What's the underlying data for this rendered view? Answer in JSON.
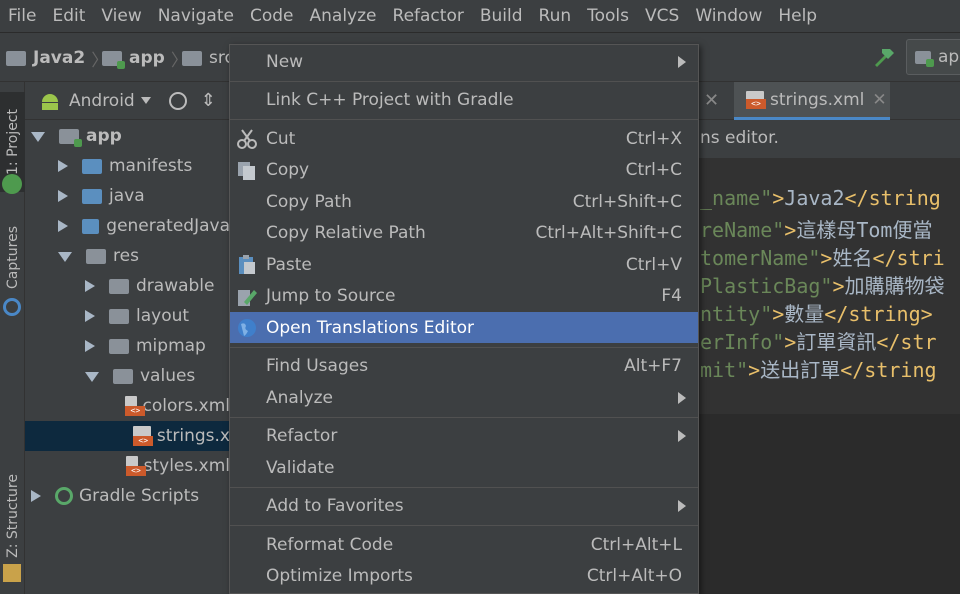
{
  "menubar": {
    "items": [
      "File",
      "Edit",
      "View",
      "Navigate",
      "Code",
      "Analyze",
      "Refactor",
      "Build",
      "Run",
      "Tools",
      "VCS",
      "Window",
      "Help"
    ]
  },
  "navbar": {
    "crumbs": [
      "Java2",
      "app",
      "src"
    ],
    "right_tab": "ap"
  },
  "toolwindows": {
    "project": "1: Project",
    "captures": "Captures",
    "structure": "Z: Structure"
  },
  "project_view": {
    "mode": "Android",
    "tree": [
      {
        "label": "app",
        "level": 0,
        "expanded": true,
        "bold": true
      },
      {
        "label": "manifests",
        "level": 1,
        "expanded": false
      },
      {
        "label": "java",
        "level": 1,
        "expanded": false
      },
      {
        "label": "generatedJava",
        "level": 1,
        "expanded": false
      },
      {
        "label": "res",
        "level": 1,
        "expanded": true
      },
      {
        "label": "drawable",
        "level": 2,
        "expanded": false
      },
      {
        "label": "layout",
        "level": 2,
        "expanded": false
      },
      {
        "label": "mipmap",
        "level": 2,
        "expanded": false
      },
      {
        "label": "values",
        "level": 2,
        "expanded": true
      },
      {
        "label": "colors.xml",
        "level": 3
      },
      {
        "label": "strings.x",
        "level": 3,
        "selected": true
      },
      {
        "label": "styles.xml",
        "level": 3
      },
      {
        "label": "Gradle Scripts",
        "level": 0,
        "expanded": false
      }
    ]
  },
  "editor": {
    "tab": "strings.xml",
    "info": "ns editor.",
    "lines": [
      {
        "attr": "_name\"",
        "text": "Java2",
        "close": "</string"
      },
      {
        "attr": "reName\"",
        "text": "這樣母Tom便當",
        "close": ""
      },
      {
        "attr": "tomerName\"",
        "text": "姓名",
        "close": "</stri"
      },
      {
        "attr": "PlasticBag\"",
        "text": "加購購物袋",
        "close": ""
      },
      {
        "attr": "ntity\"",
        "text": "數量",
        "close": "</string>"
      },
      {
        "attr": "erInfo\"",
        "text": "訂單資訊",
        "close": "</str"
      },
      {
        "attr": "mit\"",
        "text": "送出訂單",
        "close": "</string"
      }
    ]
  },
  "context_menu": {
    "items": [
      {
        "label": "New",
        "shortcut": "",
        "submenu": true,
        "icon": ""
      },
      {
        "sep": true
      },
      {
        "label": "Link C++ Project with Gradle",
        "shortcut": "",
        "icon": ""
      },
      {
        "sep": true
      },
      {
        "label": "Cut",
        "shortcut": "Ctrl+X",
        "icon": "scissors-icon"
      },
      {
        "label": "Copy",
        "shortcut": "Ctrl+C",
        "icon": "copy-icon"
      },
      {
        "label": "Copy Path",
        "shortcut": "Ctrl+Shift+C",
        "icon": ""
      },
      {
        "label": "Copy Relative Path",
        "shortcut": "Ctrl+Alt+Shift+C",
        "icon": ""
      },
      {
        "label": "Paste",
        "shortcut": "Ctrl+V",
        "icon": "paste-icon"
      },
      {
        "label": "Jump to Source",
        "shortcut": "F4",
        "icon": "edit-icon"
      },
      {
        "label": "Open Translations Editor",
        "shortcut": "",
        "icon": "globe-icon",
        "highlighted": true
      },
      {
        "sep": true
      },
      {
        "label": "Find Usages",
        "shortcut": "Alt+F7",
        "icon": ""
      },
      {
        "label": "Analyze",
        "shortcut": "",
        "submenu": true,
        "icon": ""
      },
      {
        "sep": true
      },
      {
        "label": "Refactor",
        "shortcut": "",
        "submenu": true,
        "icon": ""
      },
      {
        "label": "Validate",
        "shortcut": "",
        "icon": ""
      },
      {
        "sep": true
      },
      {
        "label": "Add to Favorites",
        "shortcut": "",
        "submenu": true,
        "icon": ""
      },
      {
        "sep": true
      },
      {
        "label": "Reformat Code",
        "shortcut": "Ctrl+Alt+L",
        "icon": ""
      },
      {
        "label": "Optimize Imports",
        "shortcut": "Ctrl+Alt+O",
        "icon": ""
      }
    ]
  },
  "colors": {
    "highlight": "#4b6eaf",
    "selection": "#0d293e",
    "string": "#6a8759",
    "tag": "#e8bf6a"
  }
}
